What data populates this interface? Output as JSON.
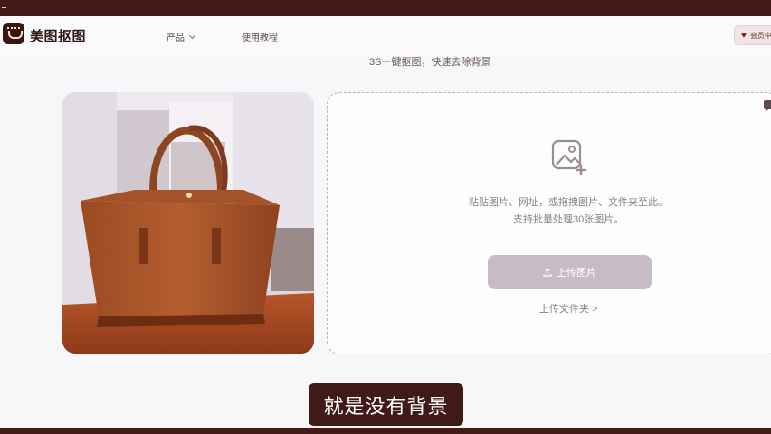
{
  "app": {
    "brand_name": "美图抠图"
  },
  "nav": {
    "product_label": "产品",
    "tutorial_label": "使用教程",
    "right_button_label": "会员中心"
  },
  "main": {
    "tagline": "3S一键抠图，快速去除背景",
    "upload": {
      "hint_line1": "粘贴图片、网址，或拖拽图片、文件夹至此。",
      "hint_line2": "支持批量处理30张图片。",
      "button_label": "上传图片",
      "folder_link": "上传文件夹 >"
    }
  },
  "subtitle": {
    "text": "就是没有背景"
  },
  "colors": {
    "frame": "#451915",
    "accent_button": "#c7bcc6",
    "bag": "#a9552a",
    "subtitle_bg": "#401a16"
  },
  "icons": [
    "image-add-icon",
    "upload-arrow-icon",
    "chevron-down-icon",
    "heart-icon",
    "chat-icon"
  ]
}
